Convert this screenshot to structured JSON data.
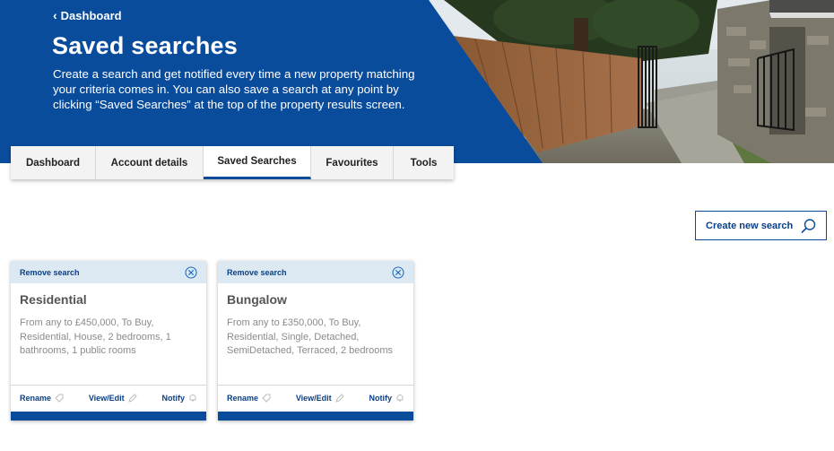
{
  "header": {
    "back_label": "Dashboard",
    "title": "Saved searches",
    "intro": "Create a search and get notified every time a new property matching your criteria comes in. You can also save a search at any point by clicking “Saved Searches” at the top of the property results screen."
  },
  "tabs": [
    {
      "label": "Dashboard"
    },
    {
      "label": "Account details"
    },
    {
      "label": "Saved Searches",
      "active": true
    },
    {
      "label": "Favourites"
    },
    {
      "label": "Tools"
    }
  ],
  "create_button": {
    "label": "Create new search",
    "icon": "search-icon"
  },
  "saved_searches": [
    {
      "remove_label": "Remove search",
      "title": "Residential",
      "criteria": "From any to £450,000, To Buy, Residential, House, 2 bedrooms, 1 bathrooms, 1 public rooms",
      "actions": [
        "Rename",
        "View/Edit",
        "Notify"
      ]
    },
    {
      "remove_label": "Remove search",
      "title": "Bungalow",
      "criteria": "From any to £350,000, To Buy, Residential, Single, Detached, SemiDetached, Terraced, 2 bedrooms",
      "actions": [
        "Rename",
        "View/Edit",
        "Notify"
      ]
    }
  ],
  "colors": {
    "brand_blue": "#0a4c9c",
    "card_header": "#dce8f2",
    "muted_text": "#8a8a8a"
  }
}
